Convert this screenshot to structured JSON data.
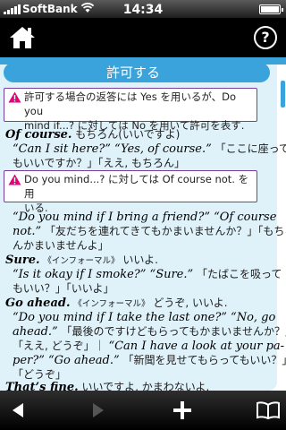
{
  "status_bar": {
    "carrier": "SoftBank",
    "time": "14:34",
    "battery_level_percent": 100
  },
  "toolbar": {
    "home_icon": "home-icon",
    "help_label": "?"
  },
  "section": {
    "title": "許可する",
    "note1": {
      "icon": "warning-icon",
      "line1": "許可する場合の返答には Yes を用いるが、Do you",
      "line2": "mind if...? に対しては No を用いて許可を表す."
    },
    "ex1": {
      "head": "Of course.",
      "head_gloss": "もちろん(いいですよ)",
      "l1_eng": "“Can I sit here?” “Yes, of course.”",
      "l1_jp": "「ここに座って",
      "l2": "もいいですか？」「ええ, もちろん」"
    },
    "note2": {
      "icon": "warning-icon",
      "line1": "Do you mind...? に対しては Of course not. を用",
      "line2": "いる."
    },
    "ex2": {
      "l1": "“Do you mind if I bring a friend?” “Of course",
      "l2_eng": "not.”",
      "l2_jp": "「友だちを連れてきてもかまいませんか？」「もちろ",
      "l3": "んかまいませんよ」"
    },
    "ex3": {
      "head": "Sure.",
      "register": "《インフォーマル》",
      "head_gloss": "いいよ.",
      "l1_eng": "“Is it okay if I smoke?” “Sure.”",
      "l1_jp": "「たばこを吸って",
      "l2": "もいい？」「いいよ」"
    },
    "ex4": {
      "head": "Go ahead.",
      "register": "《インフォーマル》",
      "head_gloss": "どうぞ, いいよ.",
      "l1": "“Do you mind if I take the last one?” “No, go",
      "l2_eng": "ahead.”",
      "l2_jp": "「最後のですけどもらってもかまいませんか？」",
      "l3_jp": "「ええ, どうぞ」｜",
      "l3_eng": "“Can I have a look at your pa-",
      "l4_eng": "per?” “Go ahead.”",
      "l4_jp": "「新聞を見せてもらってもいい？」",
      "l5": "「どうぞ」"
    },
    "ex5": {
      "head": "That’s fine.",
      "head_gloss": "いいですよ, かまわないよ."
    }
  },
  "bottom_bar": {
    "back_icon": "back-arrow-icon",
    "forward_icon": "forward-arrow-icon",
    "add_icon": "add-icon",
    "bookmark_icon": "book-icon"
  }
}
